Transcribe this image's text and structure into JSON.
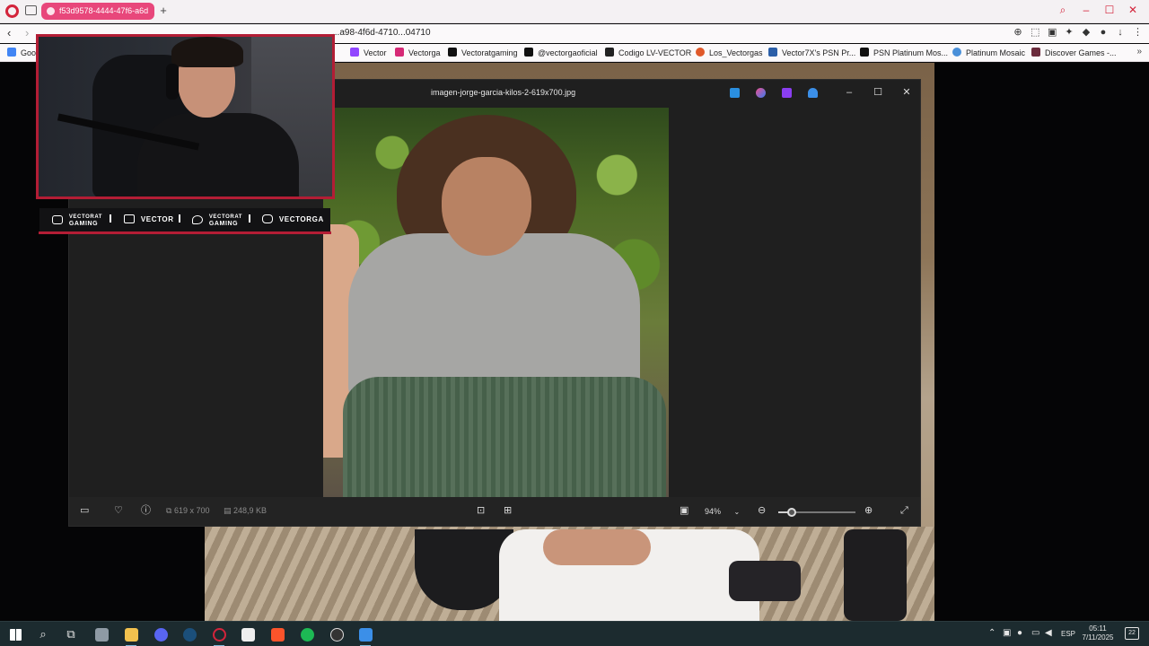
{
  "browser": {
    "tab_title": "f53d9578-4444-47f6-a6d",
    "url": "...a98-4f6d-4710...04710",
    "bookmarks": [
      {
        "label": "Goo",
        "color": "#4285f4"
      },
      {
        "label": "Vector",
        "color": "#9146ff"
      },
      {
        "label": "Vectorga",
        "color": "#d62976"
      },
      {
        "label": "Vectoratgaming",
        "color": "#111111"
      },
      {
        "label": "@vectorgaoficial",
        "color": "#111111"
      },
      {
        "label": "Codigo LV-VECTOR",
        "color": "#222222"
      },
      {
        "label": "Los_Vectorgas",
        "color": "#e0592a"
      },
      {
        "label": "Vector7X's PSN Pr...",
        "color": "#2c5fa8"
      },
      {
        "label": "PSN Platinum Mos...",
        "color": "#111111"
      },
      {
        "label": "Platinum Mosaic",
        "color": "#4a90d9"
      },
      {
        "label": "Discover Games -...",
        "color": "#6b2b3c"
      }
    ]
  },
  "viewer": {
    "title": "imagen-jorge-garcia-kilos-2-619x700.jpg",
    "dimensions": "619 x 700",
    "file_size": "248,9 KB",
    "zoom": "94%",
    "zoom_level_percent": 17
  },
  "webcam": {
    "socials": [
      {
        "icon": "youtube-icon",
        "top": "VECTORAT",
        "bottom": "GAMING"
      },
      {
        "icon": "twitch-icon",
        "top": "",
        "bottom": "VECTOR"
      },
      {
        "icon": "twitter-icon",
        "top": "VECTORAT",
        "bottom": "GAMING"
      },
      {
        "icon": "instagram-icon",
        "top": "",
        "bottom": "VECTORGA"
      }
    ]
  },
  "taskbar": {
    "language": "ESP",
    "time": "05:11",
    "date": "7/11/2025",
    "notifications": "22"
  },
  "colors": {
    "accent": "#e8477b",
    "stream_red": "#b31d35",
    "taskbar": "#1c2b2f"
  }
}
